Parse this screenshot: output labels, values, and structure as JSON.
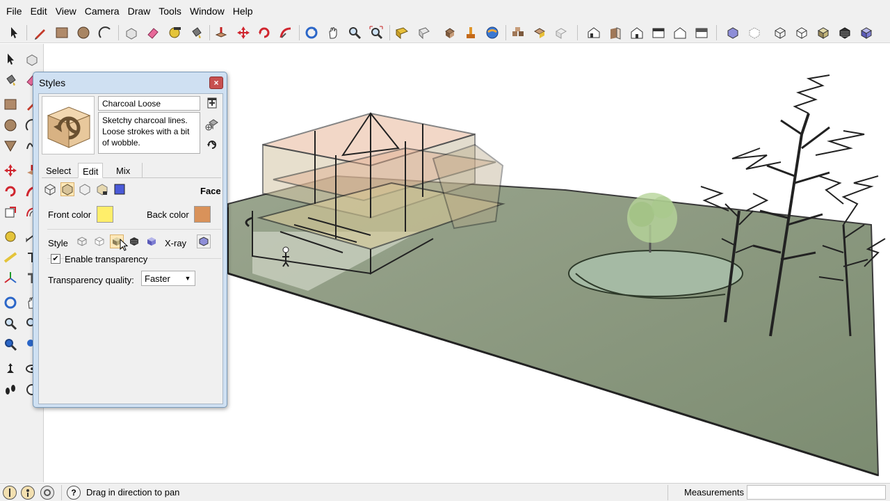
{
  "menubar": {
    "items": [
      "File",
      "Edit",
      "View",
      "Camera",
      "Draw",
      "Tools",
      "Window",
      "Help"
    ]
  },
  "styles_dialog": {
    "title": "Styles",
    "close_label": "×",
    "style_name": "Charcoal Loose",
    "description": "Sketchy charcoal lines. Loose strokes with a bit of wobble.",
    "tabs": [
      "Select",
      "Edit",
      "Mix"
    ],
    "active_tab": "Edit",
    "section_label": "Face",
    "front_color_label": "Front color",
    "front_color": "#ffee6a",
    "back_color_label": "Back color",
    "back_color": "#d9925a",
    "style_label": "Style",
    "xray_label": "X-ray",
    "enable_transparency_label": "Enable transparency",
    "enable_transparency_checked": true,
    "check_mark": "✔",
    "transparency_quality_label": "Transparency quality:",
    "transparency_quality_value": "Faster",
    "dropdown_arrow": "▼"
  },
  "statusbar": {
    "help_icon": "?",
    "status_text": "Drag in direction to pan",
    "measurements_label": "Measurements",
    "measurements_value": ""
  },
  "colors": {
    "ground": "#7f9175",
    "pond": "#9fb6a1",
    "tree_canopy": "#b6d49a",
    "house_warm": "#e8b89a"
  }
}
